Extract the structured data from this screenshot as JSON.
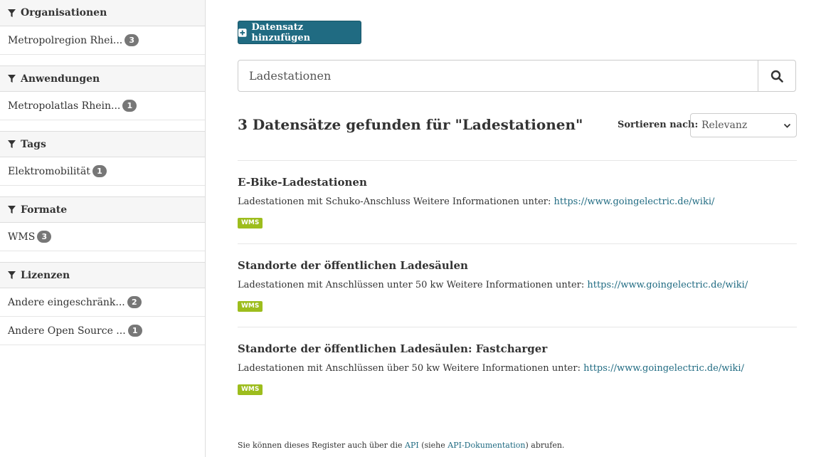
{
  "sidebar": {
    "facets": [
      {
        "title": "Organisationen",
        "items": [
          {
            "label": "Metropolregion Rhei...",
            "count": "3"
          }
        ]
      },
      {
        "title": "Anwendungen",
        "items": [
          {
            "label": "Metropolatlas Rhein...",
            "count": "1"
          }
        ]
      },
      {
        "title": "Tags",
        "items": [
          {
            "label": "Elektromobilität",
            "count": "1"
          }
        ]
      },
      {
        "title": "Formate",
        "items": [
          {
            "label": "WMS",
            "count": "3"
          }
        ]
      },
      {
        "title": "Lizenzen",
        "items": [
          {
            "label": "Andere eingeschränk...",
            "count": "2"
          },
          {
            "label": "Andere Open Source ...",
            "count": "1"
          }
        ]
      }
    ]
  },
  "toolbar": {
    "add_label": "Datensatz hinzufügen"
  },
  "search": {
    "value": "Ladestationen"
  },
  "results": {
    "count_text": "3 Datensätze gefunden für \"Ladestationen\""
  },
  "sort": {
    "label": "Sortieren nach:",
    "selected": "Relevanz"
  },
  "datasets": [
    {
      "title": "E-Bike-Ladestationen",
      "desc": "Ladestationen mit Schuko-Anschluss Weitere Informationen unter: ",
      "link": "https://www.goingelectric.de/wiki/",
      "tag": "WMS"
    },
    {
      "title": "Standorte der öffentlichen Ladesäulen",
      "desc": "Ladestationen mit Anschlüssen unter 50 kw Weitere Informationen unter: ",
      "link": "https://www.goingelectric.de/wiki/",
      "tag": "WMS"
    },
    {
      "title": "Standorte der öffentlichen Ladesäulen: Fastcharger",
      "desc": "Ladestationen mit Anschlüssen über 50 kw Weitere Informationen unter: ",
      "link": "https://www.goingelectric.de/wiki/",
      "tag": "WMS"
    }
  ],
  "footer": {
    "text_before": "Sie können dieses Register auch über die ",
    "api_link": "API",
    "text_middle": " (siehe ",
    "docs_link": "API-Dokumentation",
    "text_after": ") abrufen."
  },
  "colors": {
    "primary": "#206b82",
    "tag": "#9dbd1d",
    "badge": "#777777"
  },
  "icons": {
    "facet": "funnel-icon",
    "add": "plus-square-icon",
    "search": "search-icon",
    "sort": "chevron-down-icon"
  }
}
